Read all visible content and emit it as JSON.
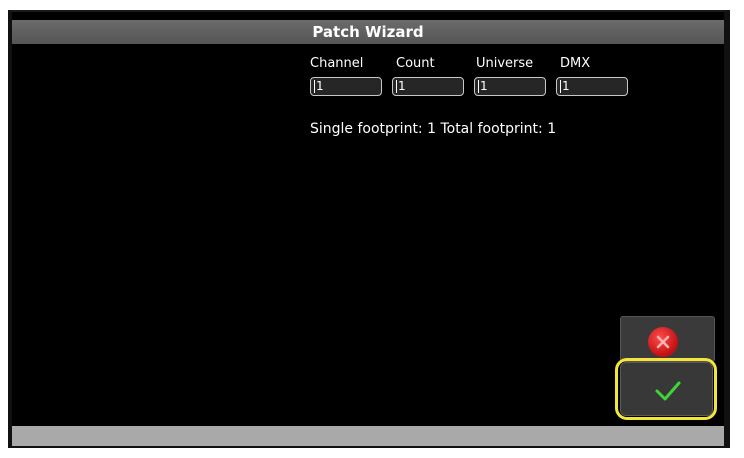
{
  "window": {
    "title": "Patch Wizard"
  },
  "fields": [
    {
      "label": "Channel",
      "value": "1"
    },
    {
      "label": "Count",
      "value": "1"
    },
    {
      "label": "Universe",
      "value": "1"
    },
    {
      "label": "DMX",
      "value": "1"
    }
  ],
  "footprint": {
    "text": "Single footprint: 1 Total footprint: 1"
  },
  "buttons": {
    "cancel_icon": "close-circle-icon",
    "ok_icon": "checkmark-icon"
  },
  "colors": {
    "highlight": "#f4e53a",
    "cancel": "#d81c1c",
    "ok_check": "#3fd43a"
  }
}
